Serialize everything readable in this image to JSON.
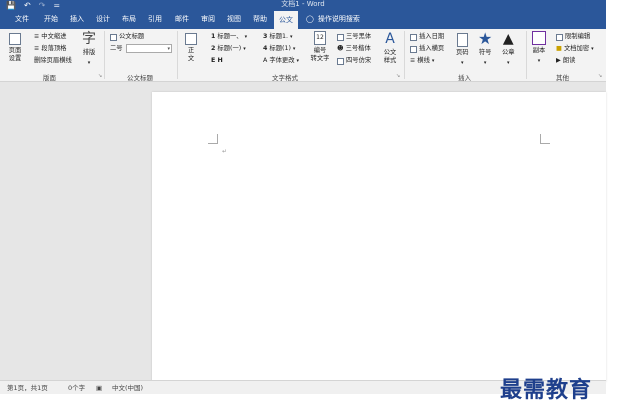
{
  "window": {
    "title": "文档1 - Word"
  },
  "quick_access": {
    "save_icon": "save-icon",
    "undo_icon": "undo-icon",
    "redo_icon": "redo-icon",
    "customize": "="
  },
  "tabs": [
    "文件",
    "开始",
    "插入",
    "设计",
    "布局",
    "引用",
    "邮件",
    "审阅",
    "视图",
    "帮助",
    "公文"
  ],
  "active_tab": "公文",
  "tell_me": "操作说明搜索",
  "ribbon": {
    "layout_group": {
      "label": "版面",
      "page_setup": "页面\n设置",
      "chinese_indent": "中文缩进",
      "para_spacing": "段落顶格",
      "remove_header_line": "删除页眉横线",
      "typeset": "排版"
    },
    "title_group": {
      "label": "公文标题",
      "doc_title": "公文标题",
      "size_label": "二号",
      "size_value": ""
    },
    "text_format_group": {
      "label": "文字格式",
      "body": "正\n文",
      "h1_a": "标题一、",
      "h2_a": "标题(一)",
      "h_label": "E H",
      "h3": "标题1.",
      "h4": "标题(1)",
      "font_change": "字体更改",
      "numbering": "编号\n转文字",
      "font_black": "三号黑体",
      "font_kai": "三号楷体",
      "font_fangsong": "四号仿宋",
      "doc_style": "公文\n样式"
    },
    "insert_group": {
      "label": "插入",
      "insert_date": "插入日期",
      "insert_landscape": "插入横页",
      "horizontal_line": "横线",
      "page_number": "页码",
      "symbol": "符号",
      "seal": "公章"
    },
    "other_group": {
      "label": "其他",
      "copy": "副本",
      "restrict_edit": "限制编辑",
      "doc_encrypt": "文档加密",
      "read": "朗读"
    }
  },
  "status": {
    "page": "第1页，共1页",
    "words": "0个字",
    "lang": "中文(中国)"
  },
  "watermark": "最需教育",
  "colors": {
    "accent": "#2b579a",
    "ribbon_bg": "#f3f3f3",
    "workspace": "#e6e6e6"
  }
}
